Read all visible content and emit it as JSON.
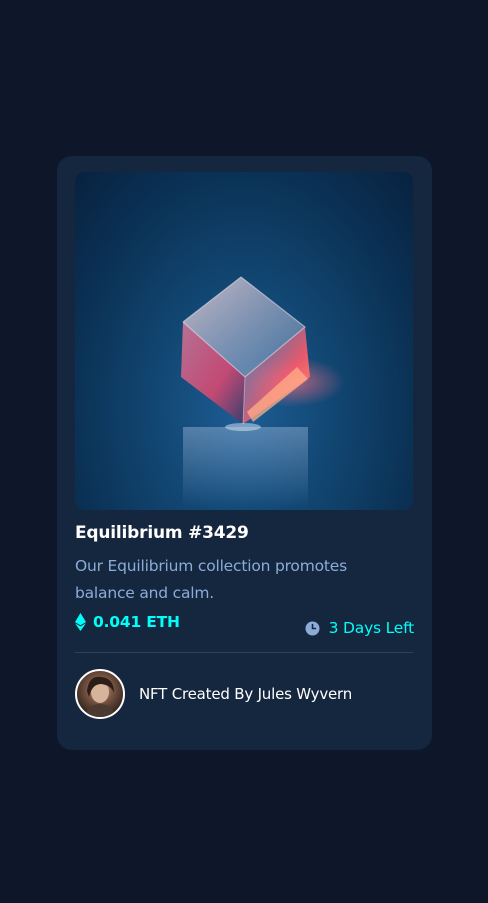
{
  "nft": {
    "title": "Equilibrium #3429",
    "description": "Our Equilibrium collection promotes balance and calm.",
    "price": "0.041 ETH",
    "time_left": "3 Days Left",
    "creator_text": "NFT Created By Jules Wyvern"
  },
  "icons": {
    "price": "ethereum-icon",
    "time": "clock-icon"
  },
  "colors": {
    "page_bg": "#0d1729",
    "card_bg": "#15263f",
    "accent_cyan": "#00fff8",
    "soft_blue": "#8bacd9",
    "white": "#ffffff",
    "divider": "#2e405a"
  }
}
